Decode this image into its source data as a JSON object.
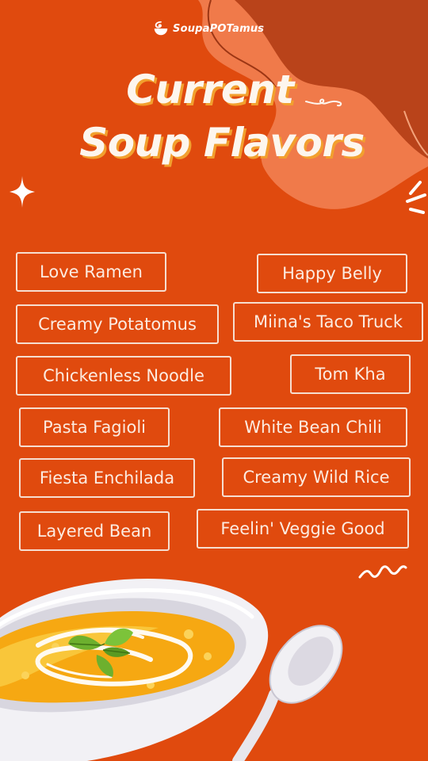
{
  "brand": {
    "name": "SoupaPOTamus",
    "icon": "soup-swirl-logo"
  },
  "title": {
    "line1": "Current",
    "line2": "Soup Flavors"
  },
  "flavors": [
    "Love Ramen",
    "Happy Belly",
    "Creamy Potatomus",
    "Miina's Taco Truck",
    "Chickenless Noodle",
    "Tom Kha",
    "Pasta Fagioli",
    "White Bean Chili",
    "Fiesta Enchilada",
    "Creamy Wild Rice",
    "Layered Bean",
    "Feelin' Veggie Good"
  ],
  "colors": {
    "background": "#e04a0e",
    "blob_light": "#f07a4a",
    "blob_dark": "#b9431a",
    "title_text": "#fdf6ee",
    "title_shadow": "#f2a02e",
    "box_border": "#f6ded0",
    "soup": "#f6a812"
  },
  "decorations": [
    "sparkle-icon",
    "rays-icon",
    "squiggle-wave-icon",
    "soup-bowl-illustration",
    "spoon-illustration",
    "basil-leaves"
  ]
}
